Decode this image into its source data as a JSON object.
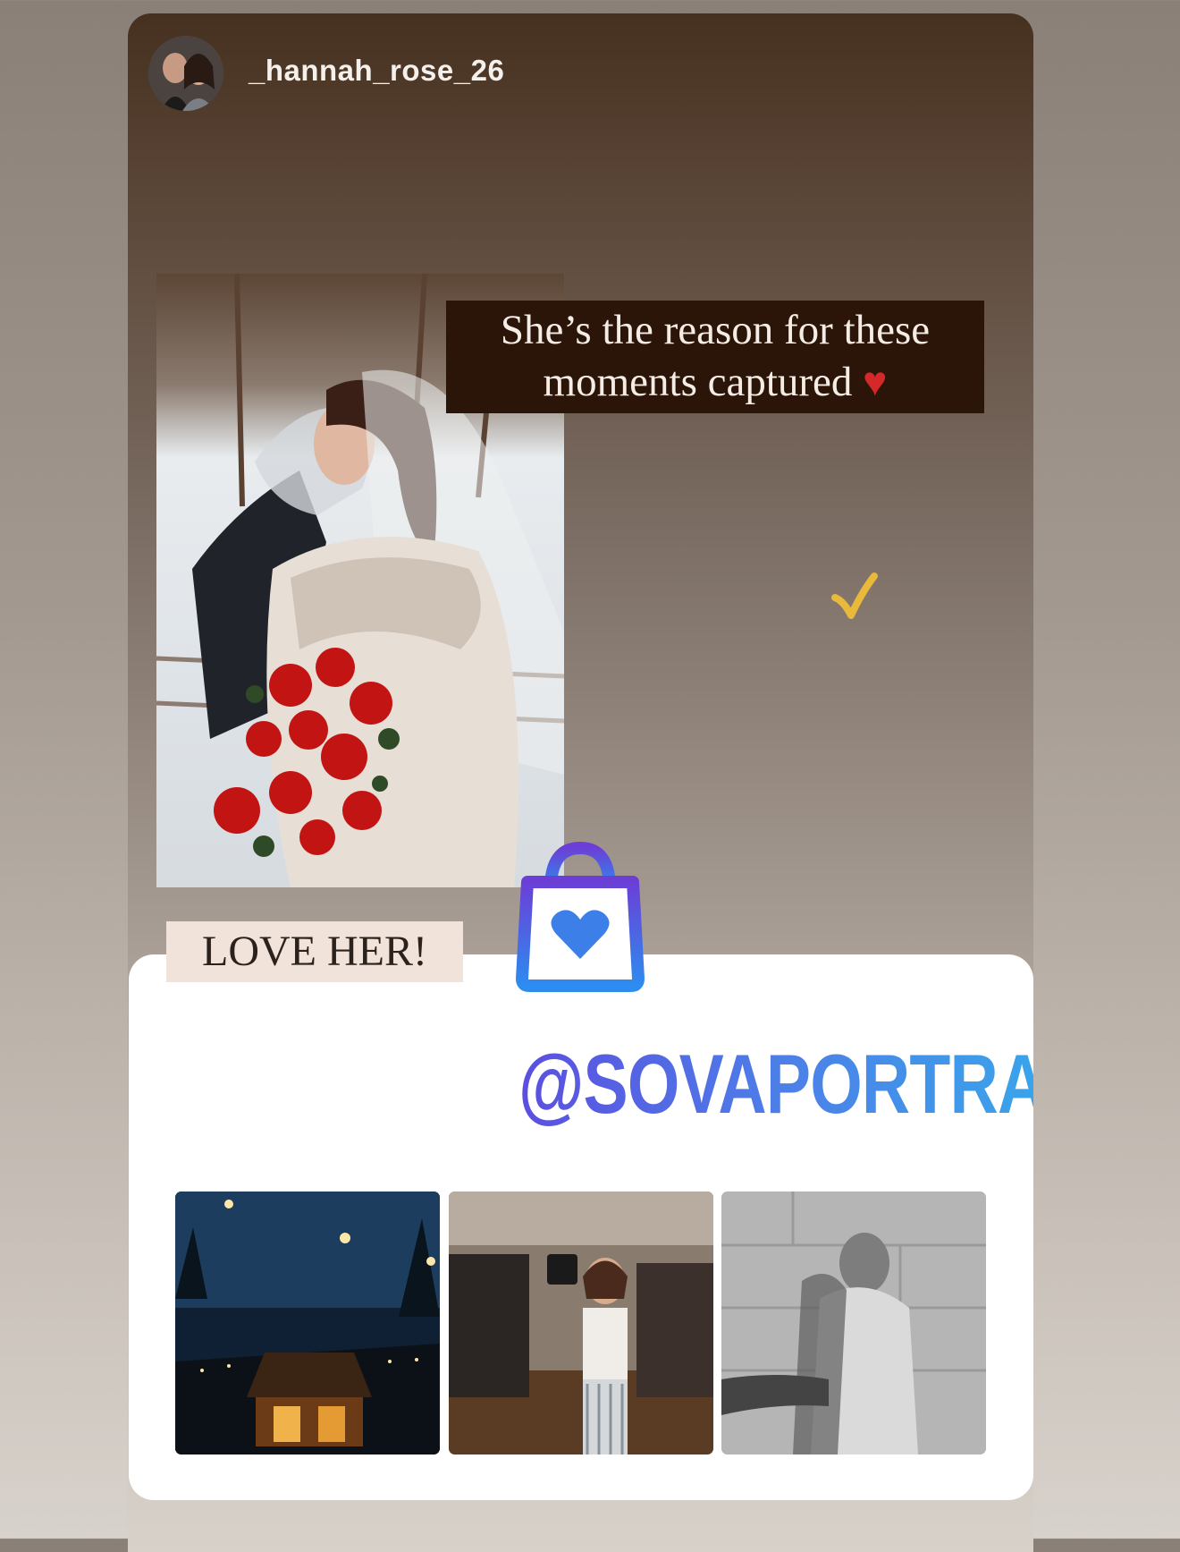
{
  "story": {
    "username": "_hannah_rose_26",
    "caption_line1": "She’s the reason for these",
    "caption_line2": "moments captured",
    "sticker_text": "LOVE HER!"
  },
  "shop_card": {
    "handle": "@SOVAPORTRAIT",
    "thumbnails": [
      "thumbnail-barn-night",
      "thumbnail-photographer-dancing",
      "thumbnail-couple-bw"
    ]
  },
  "colors": {
    "caption_bg": "#2b1509",
    "heart": "#d52828",
    "handle_gradient_start": "#5b4fe0",
    "handle_gradient_end": "#3aa3ea",
    "check": "#e8b93a"
  }
}
